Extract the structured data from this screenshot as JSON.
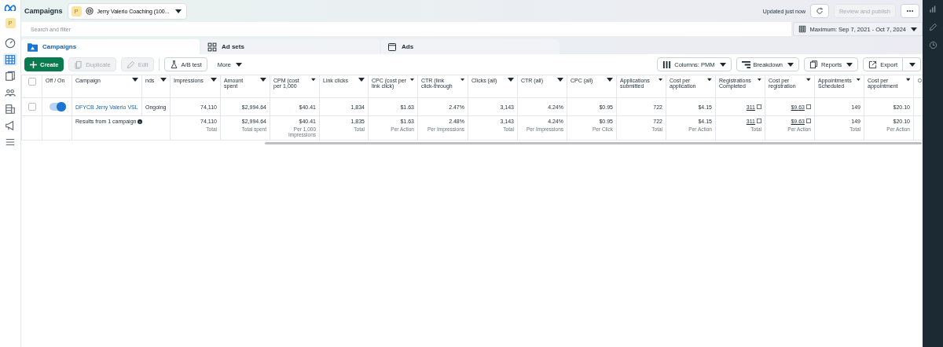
{
  "sidebar": {
    "account_badge": "P",
    "items": [
      {
        "kind": "gauge",
        "selected": false
      },
      {
        "kind": "table",
        "selected": true
      },
      {
        "kind": "pages",
        "selected": false
      },
      {
        "kind": "people",
        "selected": false
      },
      {
        "kind": "stack",
        "selected": false
      },
      {
        "kind": "megaphone",
        "selected": false
      },
      {
        "kind": "menu",
        "selected": false
      }
    ]
  },
  "header": {
    "title": "Campaigns",
    "account": {
      "badge": "P",
      "name": "Jerry Valerio Coaching (100..."
    },
    "status": "Updated just now",
    "publish_button": {
      "label": "Review and publish",
      "disabled": true
    }
  },
  "search": {
    "placeholder": "Search and filter"
  },
  "date_range": "Maximum: Sep 7, 2021 - Oct 7, 2024",
  "tabs": [
    {
      "label": "Campaigns",
      "kind": "folder",
      "selected": true
    },
    {
      "label": "Ad sets",
      "kind": "grid",
      "selected": false
    },
    {
      "label": "Ads",
      "kind": "page",
      "selected": false
    }
  ],
  "toolbar": {
    "left": [
      {
        "label": "Create",
        "kind": "create"
      },
      {
        "label": "Duplicate",
        "kind": "duplicate",
        "disabled": true
      },
      {
        "label": "Edit",
        "kind": "edit",
        "disabled": true
      },
      {
        "label": "A/B test",
        "kind": "flask",
        "disabled": false
      },
      {
        "label": "More",
        "kind": "menu"
      }
    ],
    "right": [
      {
        "label": "Columns: PMM",
        "kind": "columns"
      },
      {
        "label": "Breakdown",
        "kind": "breakdown"
      },
      {
        "label": "Reports",
        "kind": "reports"
      },
      {
        "label": "Export",
        "kind": "export"
      }
    ]
  },
  "table": {
    "select_all": {
      "checked": false
    },
    "frozen_columns": [
      "Off / On",
      "Campaign",
      "nds"
    ],
    "columns": [
      "Impressions",
      "Amount spent",
      "CPM (cost per 1,000",
      "Link clicks",
      "CPC (cost per link click)",
      "CTR (link click-through",
      "Clicks (all)",
      "CTR (all)",
      "CPC (all)",
      "Applications submitted",
      "Cost per application",
      "Registrations Completed",
      "Cost per registration",
      "Appointments Scheduled",
      "Cost per appointment"
    ],
    "rows": [
      {
        "kind": "campaign",
        "checked": false,
        "on": true,
        "name": "DFYCB Jerry Valerio VSL",
        "delivery": "Ongoing",
        "cells": [
          {
            "text": "74,110"
          },
          {
            "text": "$2,994.64"
          },
          {
            "text": "$40.41"
          },
          {
            "text": "1,834"
          },
          {
            "text": "$1.63"
          },
          {
            "text": "2.47%"
          },
          {
            "text": "3,143"
          },
          {
            "text": "4.24%"
          },
          {
            "text": "$0.95"
          },
          {
            "text": "722"
          },
          {
            "text": "$4.15"
          },
          {
            "text": "311",
            "kind": "link"
          },
          {
            "text": "$9.63",
            "kind": "link"
          },
          {
            "text": "149"
          },
          {
            "text": "$20.10"
          }
        ]
      },
      {
        "kind": "total",
        "name": "Results from 1 campaign",
        "cells": [
          {
            "text": "74,110",
            "sub": "Total"
          },
          {
            "text": "$2,994.64",
            "sub": "Total spent"
          },
          {
            "text": "$40.41",
            "sub": "Per 1,000 Impressions"
          },
          {
            "text": "1,835",
            "sub": "Total"
          },
          {
            "text": "$1.63",
            "sub": "Per Action"
          },
          {
            "text": "2.48%",
            "sub": "Per Impressions"
          },
          {
            "text": "3,143",
            "sub": "Total"
          },
          {
            "text": "4.24%",
            "sub": "Per Impressions"
          },
          {
            "text": "$0.95",
            "sub": "Per Click"
          },
          {
            "text": "722",
            "sub": "Total"
          },
          {
            "text": "$4.15",
            "sub": "Per Action"
          },
          {
            "text": "311",
            "kind": "link",
            "sub": "Total"
          },
          {
            "text": "$9.63",
            "kind": "link",
            "sub": "Per Action"
          },
          {
            "text": "149",
            "sub": "Total"
          },
          {
            "text": "$20.10",
            "sub": "Per Action"
          }
        ]
      }
    ]
  }
}
